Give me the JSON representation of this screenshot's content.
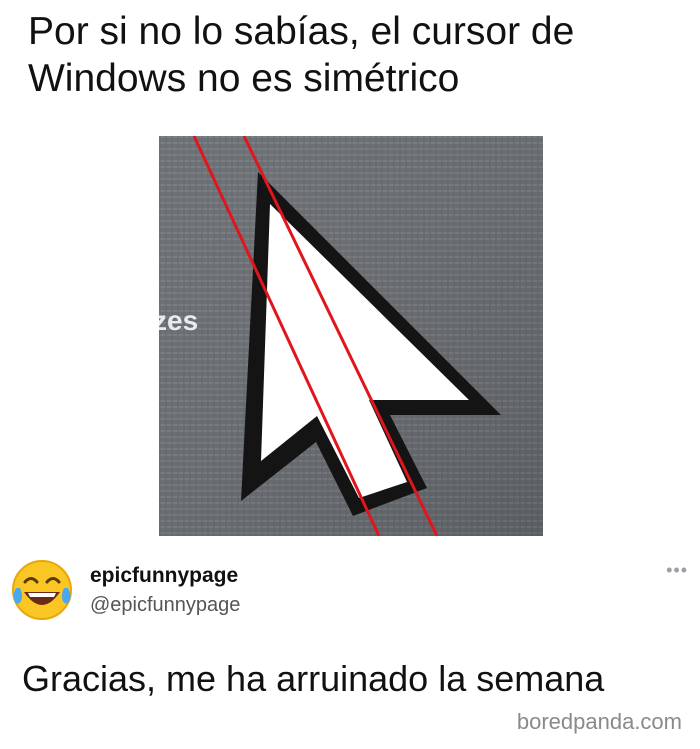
{
  "post": {
    "caption": "Por si no lo sabías, el cursor de Windows no es simétrico",
    "image_text": "zes",
    "author": {
      "username": "epicfunnypage",
      "handle": "@epicfunnypage",
      "avatar_icon": "face-with-tears-of-joy-icon"
    },
    "more_icon": "more-options-icon",
    "more_label": "•••",
    "reply_text": "Gracias, me ha arruinado la semana",
    "watermark": "boredpanda.com"
  },
  "colors": {
    "guide_line": "#e0161c",
    "cursor_outline": "#141414",
    "cursor_fill": "#ffffff",
    "screen_bg": "#6b6f73"
  }
}
